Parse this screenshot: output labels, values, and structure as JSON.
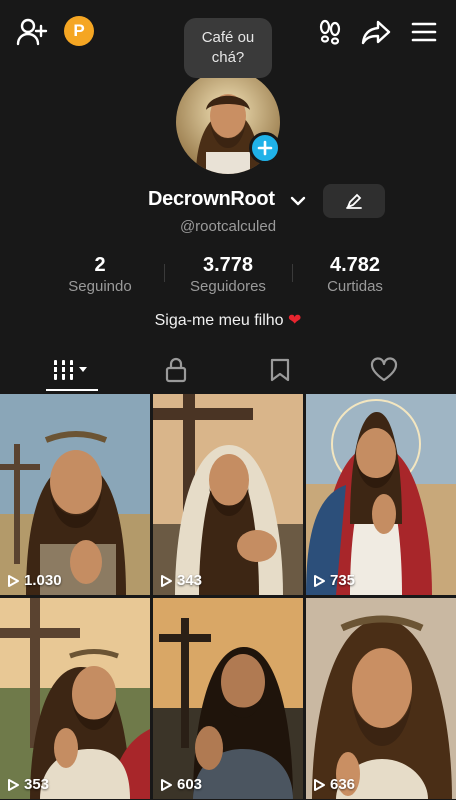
{
  "topbar": {
    "coin_letter": "P"
  },
  "bubble": {
    "text": "Café ou chá?"
  },
  "profile": {
    "name": "DecrownRoot",
    "handle": "@rootcalculed"
  },
  "stats": [
    {
      "value": "2",
      "label": "Seguindo"
    },
    {
      "value": "3.778",
      "label": "Seguidores"
    },
    {
      "value": "4.782",
      "label": "Curtidas"
    }
  ],
  "bio": {
    "text": "Siga-me meu filho",
    "emoji": "❤"
  },
  "tabs": [
    {
      "name": "videos-grid",
      "icon": "grid-bars-icon",
      "active": true
    },
    {
      "name": "private",
      "icon": "lock-icon",
      "active": false
    },
    {
      "name": "saved",
      "icon": "bookmark-icon",
      "active": false
    },
    {
      "name": "liked",
      "icon": "heart-icon",
      "active": false
    }
  ],
  "videos": [
    {
      "views": "1.030"
    },
    {
      "views": "343"
    },
    {
      "views": "735"
    },
    {
      "views": "353"
    },
    {
      "views": "603"
    },
    {
      "views": "636"
    }
  ],
  "colors": {
    "background": "#181818",
    "accent_blue": "#20b2e8",
    "coin": "#f5a623",
    "heart": "#e8252f"
  }
}
